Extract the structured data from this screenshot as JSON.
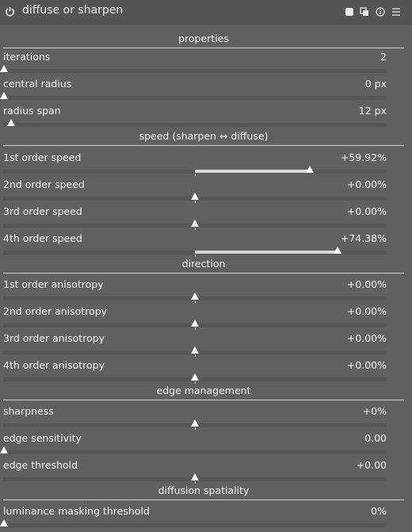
{
  "header": {
    "title": "diffuse or sharpen"
  },
  "sections": {
    "properties": "properties",
    "speed": "speed (sharpen ↔ diffuse)",
    "direction": "direction",
    "edge": "edge management",
    "spatiality": "diffusion spatiality"
  },
  "rows": {
    "iterations": {
      "label": "iterations",
      "value": "2",
      "level": 0.0
    },
    "central_radius": {
      "label": "central radius",
      "value": "0 px",
      "level": 0.0
    },
    "radius_span": {
      "label": "radius span",
      "value": "12 px",
      "level": 0.02
    },
    "speed1": {
      "label": "1st order speed",
      "value": "+59.92%",
      "level": 0.5992
    },
    "speed2": {
      "label": "2nd order speed",
      "value": "+0.00%",
      "level": 0
    },
    "speed3": {
      "label": "3rd order speed",
      "value": "+0.00%",
      "level": 0
    },
    "speed4": {
      "label": "4th order speed",
      "value": "+74.38%",
      "level": 0.7438
    },
    "aniso1": {
      "label": "1st order anisotropy",
      "value": "+0.00%",
      "level": 0
    },
    "aniso2": {
      "label": "2nd order anisotropy",
      "value": "+0.00%",
      "level": 0
    },
    "aniso3": {
      "label": "3rd order anisotropy",
      "value": "+0.00%",
      "level": 0
    },
    "aniso4": {
      "label": "4th order anisotropy",
      "value": "+0.00%",
      "level": 0
    },
    "sharpness": {
      "label": "sharpness",
      "value": "+0%",
      "level": 0
    },
    "edge_sensitivity": {
      "label": "edge sensitivity",
      "value": "0.00",
      "level": 0
    },
    "edge_threshold": {
      "label": "edge threshold",
      "value": "+0.00",
      "level": 0
    },
    "lum_mask": {
      "label": "luminance masking threshold",
      "value": "0%",
      "level": 0
    }
  },
  "icons": [
    "power-icon",
    "presets-icon",
    "multi-instance-icon",
    "reset-icon",
    "menu-icon"
  ]
}
